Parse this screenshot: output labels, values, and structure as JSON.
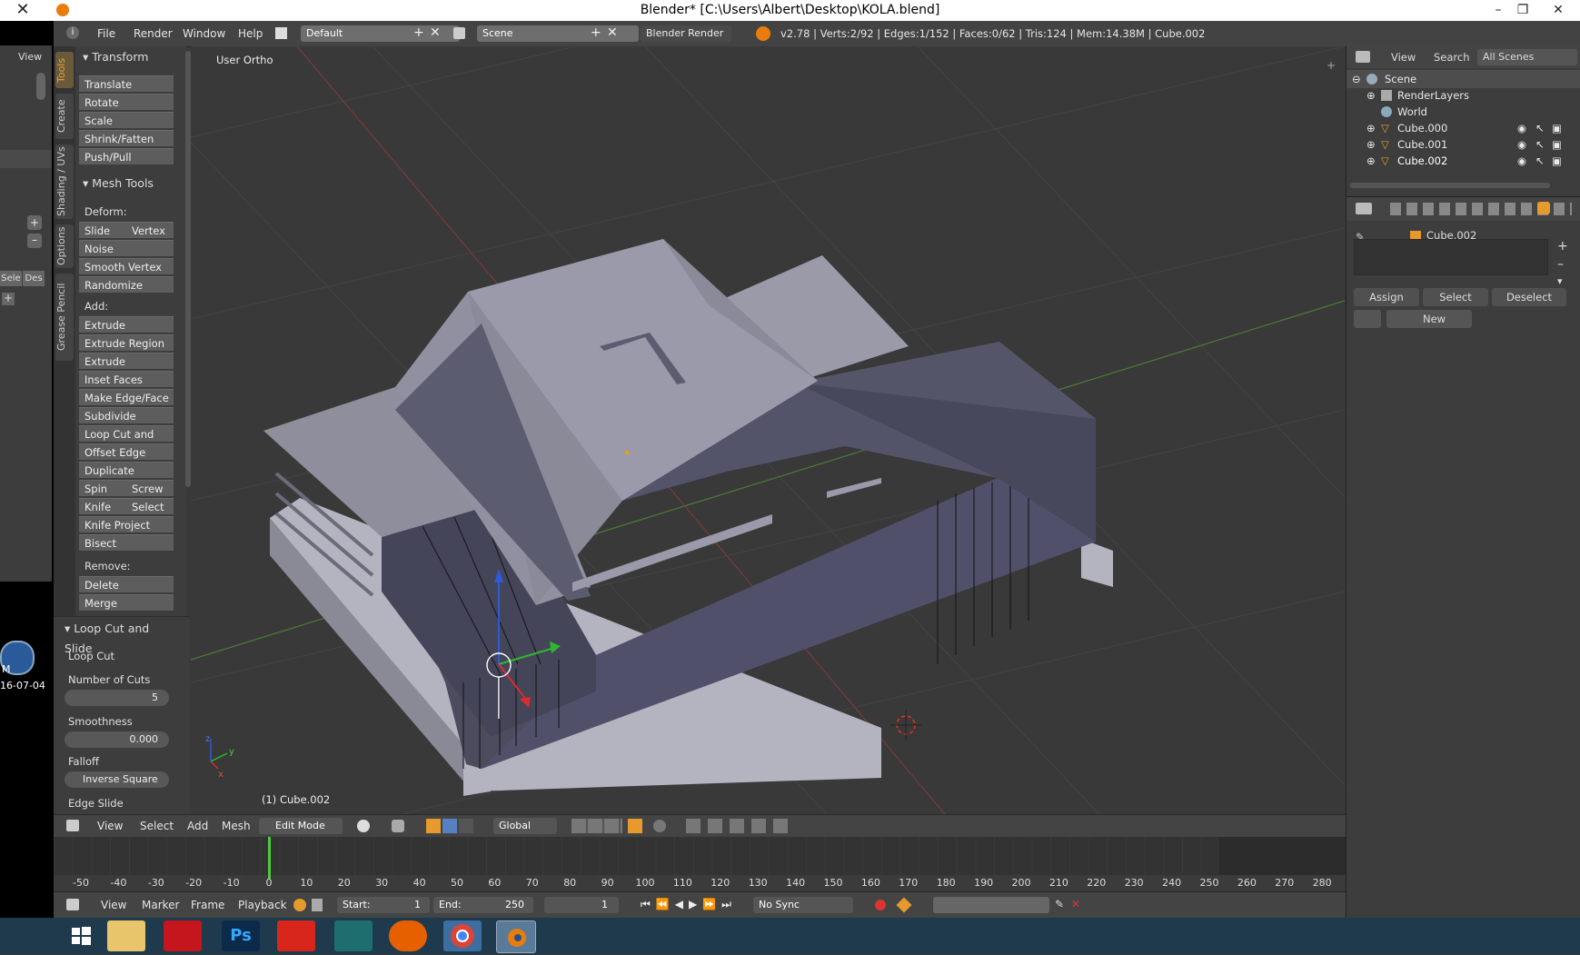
{
  "window": {
    "title": "Blender* [C:\\Users\\Albert\\Desktop\\KOLA.blend]",
    "close_glyph": "✕",
    "min_glyph": "–",
    "max_glyph": "❐",
    "x_glyph": "✕"
  },
  "infobar": {
    "menus": [
      "File",
      "Render",
      "Window",
      "Help"
    ],
    "layout": "Default",
    "scene": "Scene",
    "engine": "Blender Render",
    "stats": "v2.78 | Verts:2/92 | Edges:1/152 | Faces:0/62 | Tris:124 | Mem:14.38M | Cube.002"
  },
  "left_strip": {
    "view_label": "View",
    "sel_label": "Sele",
    "des_label": "Des",
    "time_text": "M",
    "date_text": "16-07-04"
  },
  "tabs": [
    "Tools",
    "Create",
    "Shading / UVs",
    "Options",
    "Grease Pencil"
  ],
  "toolshelf": {
    "transform_header": "Transform",
    "transform": [
      "Translate",
      "Rotate",
      "Scale",
      "Shrink/Fatten",
      "Push/Pull"
    ],
    "mesh_tools_header": "Mesh Tools",
    "deform_label": "Deform:",
    "slide_edge": "Slide Ed",
    "vertex": "Vertex",
    "deform": [
      "Noise",
      "Smooth Vertex",
      "Randomize"
    ],
    "add_label": "Add:",
    "add": [
      "Extrude",
      "Extrude Region",
      "Extrude Individual",
      "Inset Faces",
      "Make Edge/Face",
      "Subdivide",
      "Loop Cut and Slide",
      "Offset Edge Slide",
      "Duplicate"
    ],
    "spin": "Spin",
    "screw": "Screw",
    "knife": "Knife",
    "select": "Select",
    "add2": [
      "Knife Project",
      "Bisect"
    ],
    "remove_label": "Remove:",
    "remove": [
      "Delete",
      "Merge"
    ],
    "last_op_header": "Loop Cut and Slide",
    "loop_cut": "Loop Cut",
    "cuts_label": "Number of Cuts",
    "cuts_value": "5",
    "smooth_label": "Smoothness",
    "smooth_value": "0.000",
    "falloff_label": "Falloff",
    "falloff_value": "Inverse Square",
    "edge_slide": "Edge Slide"
  },
  "viewport": {
    "view_name": "User Ortho",
    "object_name": "(1) Cube.002",
    "axis_x": "x",
    "axis_y": "y",
    "axis_z": "z"
  },
  "outliner": {
    "view": "View",
    "search": "Search",
    "all_scenes": "All Scenes",
    "items": [
      "Scene",
      "RenderLayers",
      "World",
      "Cube.000",
      "Cube.001",
      "Cube.002"
    ]
  },
  "properties": {
    "object": "Cube.002",
    "assign": "Assign",
    "select": "Select",
    "deselect": "Deselect",
    "new": "New"
  },
  "view3d_header": {
    "view": "View",
    "select": "Select",
    "add": "Add",
    "mesh": "Mesh",
    "mode": "Edit Mode",
    "orientation": "Global"
  },
  "timeline": {
    "ticks": [
      "-50",
      "-40",
      "-30",
      "-20",
      "-10",
      "0",
      "10",
      "20",
      "30",
      "40",
      "50",
      "60",
      "70",
      "80",
      "90",
      "100",
      "110",
      "120",
      "130",
      "140",
      "150",
      "160",
      "170",
      "180",
      "190",
      "200",
      "210",
      "220",
      "230",
      "240",
      "250",
      "260",
      "270",
      "280"
    ],
    "current_frame_value": 0,
    "view": "View",
    "marker": "Marker",
    "frame": "Frame",
    "playback": "Playback",
    "start_label": "Start:",
    "start_value": "1",
    "end_label": "End:",
    "end_value": "250",
    "current": "1",
    "sync": "No Sync"
  },
  "taskbar": {
    "apps": [
      "start-icon",
      "explorer-icon",
      "acrobat-icon",
      "photoshop-icon",
      "sketchup-icon",
      "maya-icon",
      "firefox-icon",
      "chrome-icon",
      "blender-icon"
    ],
    "photoshop_text": "Ps"
  },
  "colors": {
    "accent_orange": "#e69a2e",
    "selection_blue": "#5680c2",
    "mesh_dark": "#4a4a5c",
    "mesh_light": "#8c8c9a"
  }
}
